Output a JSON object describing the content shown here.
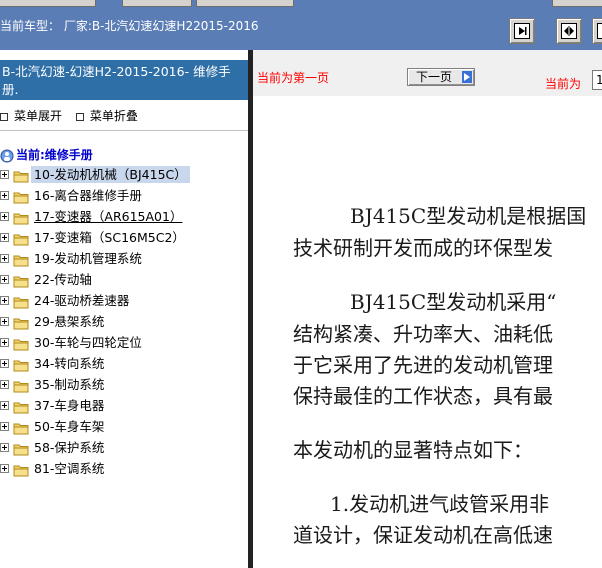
{
  "header": {
    "vehicle_info": "当前车型： 厂家:B-北汽幻速幻速H22015-2016"
  },
  "left_panel": {
    "manual_title": "B-北汽幻速-幻速H2-2015-2016- 维修手册.",
    "expand_label": "菜单展开",
    "collapse_label": "菜单折叠",
    "root_label": "当前:维修手册",
    "items": [
      {
        "label": "10-发动机机械（BJ415C）"
      },
      {
        "label": "16-离合器维修手册"
      },
      {
        "label": "17-变速器（AR615A01）"
      },
      {
        "label": "17-变速箱（SC16M5C2）"
      },
      {
        "label": "19-发动机管理系统"
      },
      {
        "label": "22-传动轴"
      },
      {
        "label": "24-驱动桥差速器"
      },
      {
        "label": "29-悬架系统"
      },
      {
        "label": "30-车轮与四轮定位"
      },
      {
        "label": "34-转向系统"
      },
      {
        "label": "35-制动系统"
      },
      {
        "label": "37-车身电器"
      },
      {
        "label": "50-车身车架"
      },
      {
        "label": "58-保护系统"
      },
      {
        "label": "81-空调系统"
      }
    ]
  },
  "doc_header": {
    "first_page_msg": "当前为第一页",
    "next_page_label": "下一页",
    "current_label": "当前为",
    "page_value": "1"
  },
  "doc": {
    "lines": [
      "BJ415C型发动机是根据国",
      "技术研制开发而成的环保型发",
      "BJ415C型发动机采用“",
      "结构紧凑、升功率大、油耗低",
      "于它采用了先进的发动机管理",
      "保持最佳的工作状态，具有最",
      "本发动机的显著特点如下：",
      "1.发动机进气歧管采用非",
      "道设计，保证发动机在高低速"
    ]
  },
  "colors": {
    "toolbar_bg": "#5a7db6",
    "title_bar_bg": "#2f6fa8",
    "accent_red": "#ff0000",
    "root_blue": "#0000cc",
    "selected_bg": "#c9d7ec"
  },
  "icons": {
    "tree_node": "folder-icon",
    "expander": "plus-expander-icon",
    "root": "globe-person-icon",
    "next": "arrow-right-icon",
    "nav_first": "nav-first-page-icon",
    "nav_fit": "nav-fit-width-icon",
    "nav_last": "nav-next-icon"
  }
}
